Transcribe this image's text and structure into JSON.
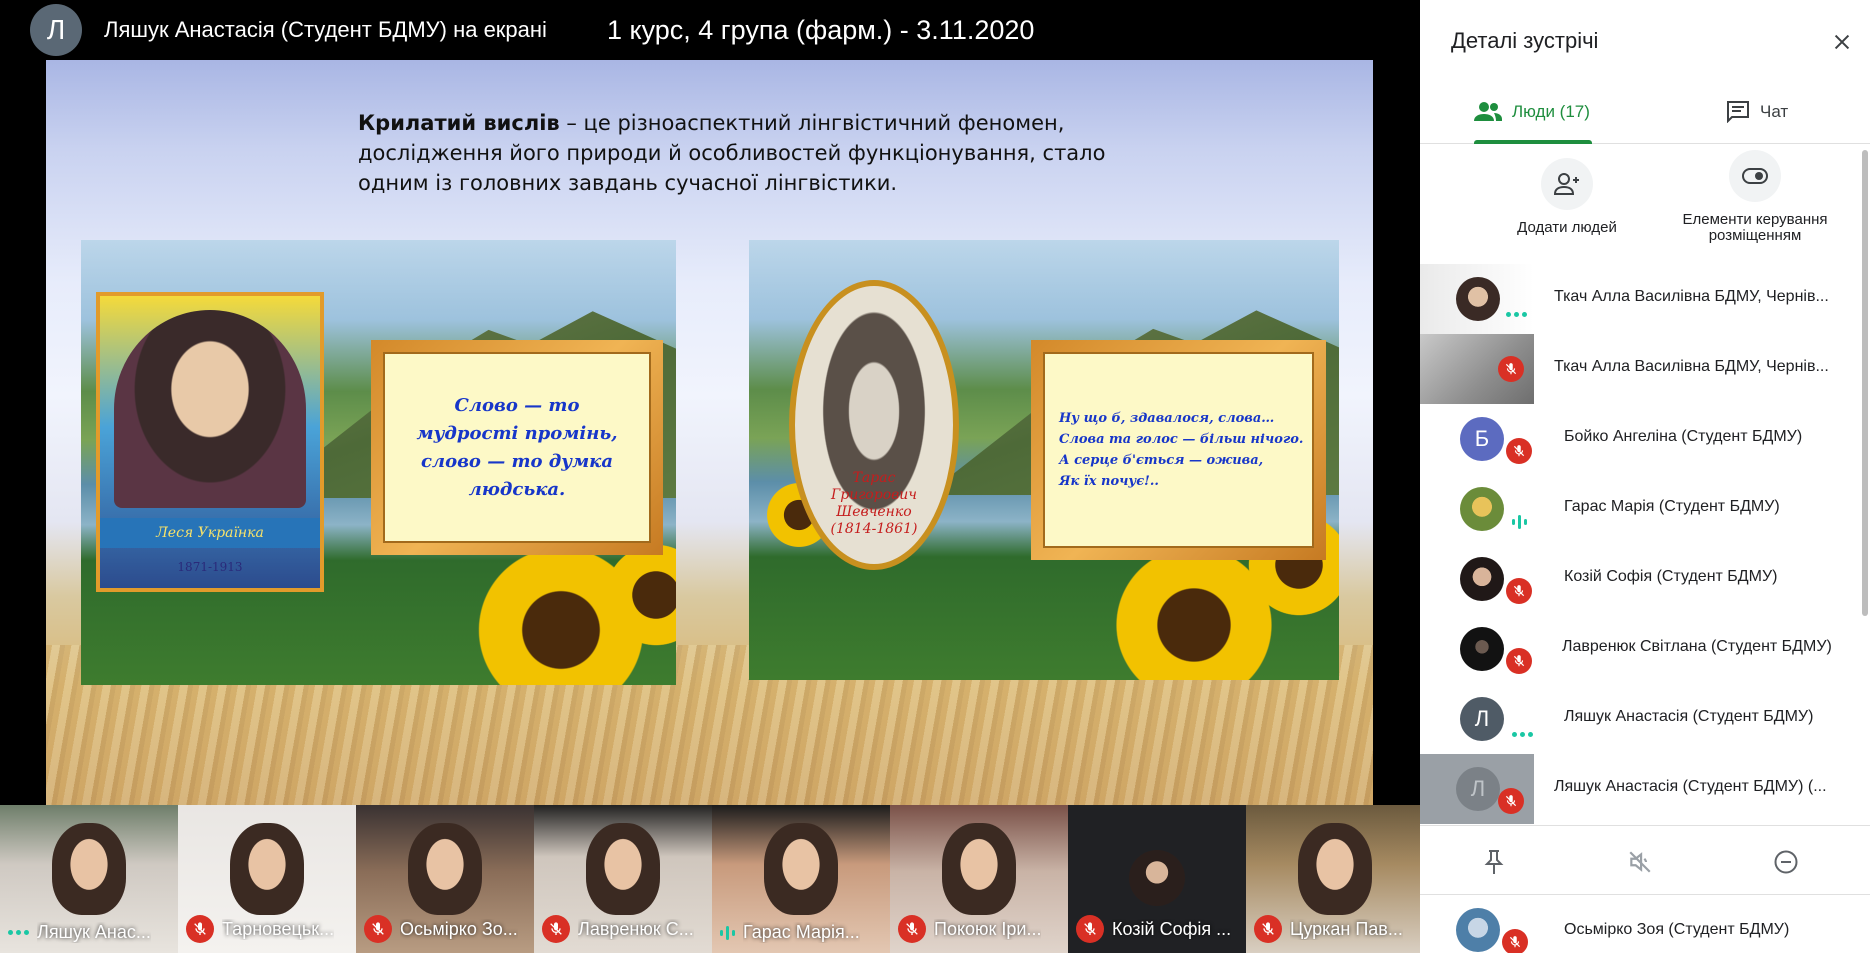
{
  "topbar": {
    "presenter_initial": "Л",
    "presenter_label": "Ляшук Анастасія (Студент БДМУ) на екрані",
    "meeting_title": "1 курс, 4 група (фарм.) - 3.11.2020"
  },
  "slide": {
    "definition_term": "Крилатий вислів",
    "definition_rest": " – це різноаспектний лінгвістичний феномен, дослідження його природи й особливостей функціонування, стало одним із головних завдань сучасної лінгвістики.",
    "left_card": {
      "portrait_name": "Леся Українка",
      "portrait_years": "1871-1913",
      "quote": "Слово — то мудрості промінь, слово — то думка людська."
    },
    "right_card": {
      "portrait_caption_line1": "Тарас Григорович",
      "portrait_caption_line2": "Шевченко",
      "portrait_caption_line3": "(1814-1861)",
      "quote_lines": [
        "Ну що б, здавалося, слова…",
        "Слова та голос — більш нічого.",
        "А серце б'ється — ожива,",
        "Як їх почує!.."
      ]
    }
  },
  "filmstrip": [
    {
      "name": "Ляшук Анас...",
      "status": "speaking-dots"
    },
    {
      "name": "Тарновецьк...",
      "status": "muted"
    },
    {
      "name": "Осьмірко Зо...",
      "status": "muted"
    },
    {
      "name": "Лавренюк С...",
      "status": "muted"
    },
    {
      "name": "Гарас Марія...",
      "status": "speaking-bars"
    },
    {
      "name": "Покоюк Іри...",
      "status": "muted"
    },
    {
      "name": "Козій Софія ...",
      "status": "muted"
    },
    {
      "name": "Цуркан Пав...",
      "status": "muted"
    }
  ],
  "panel": {
    "title": "Деталі зустрічі",
    "tab_people": "Люди (17)",
    "tab_chat": "Чат",
    "add_people": "Додати людей",
    "layout_controls": "Елементи керування розміщенням",
    "people": [
      {
        "name": "Ткач Алла Василівна БДМУ, Чернів...",
        "status": "speaking-dots"
      },
      {
        "name": "Ткач Алла Василівна БДМУ, Чернів...",
        "status": "muted"
      },
      {
        "name": "Бойко Ангеліна (Студент БДМУ)",
        "status": "muted",
        "initial": "Б"
      },
      {
        "name": "Гарас Марія (Студент БДМУ)",
        "status": "speaking-bars"
      },
      {
        "name": "Козій Софія (Студент БДМУ)",
        "status": "muted"
      },
      {
        "name": "Лавренюк Світлана (Студент БДМУ)",
        "status": "muted"
      },
      {
        "name": "Ляшук Анастасія (Студент БДМУ)",
        "status": "speaking-dots",
        "initial": "Л"
      },
      {
        "name": "Ляшук Анастасія (Студент БДМУ) (...",
        "status": "muted",
        "initial": "Л"
      }
    ],
    "last_person": {
      "name": "Осьмірко Зоя (Студент БДМУ)",
      "status": "muted"
    }
  },
  "colors": {
    "accent_green": "#1e8e3e",
    "mute_red": "#d93025",
    "speaking_teal": "#1ac7a4",
    "avatar_blue": "#5c6bc0",
    "avatar_slate": "#4f5b66"
  }
}
